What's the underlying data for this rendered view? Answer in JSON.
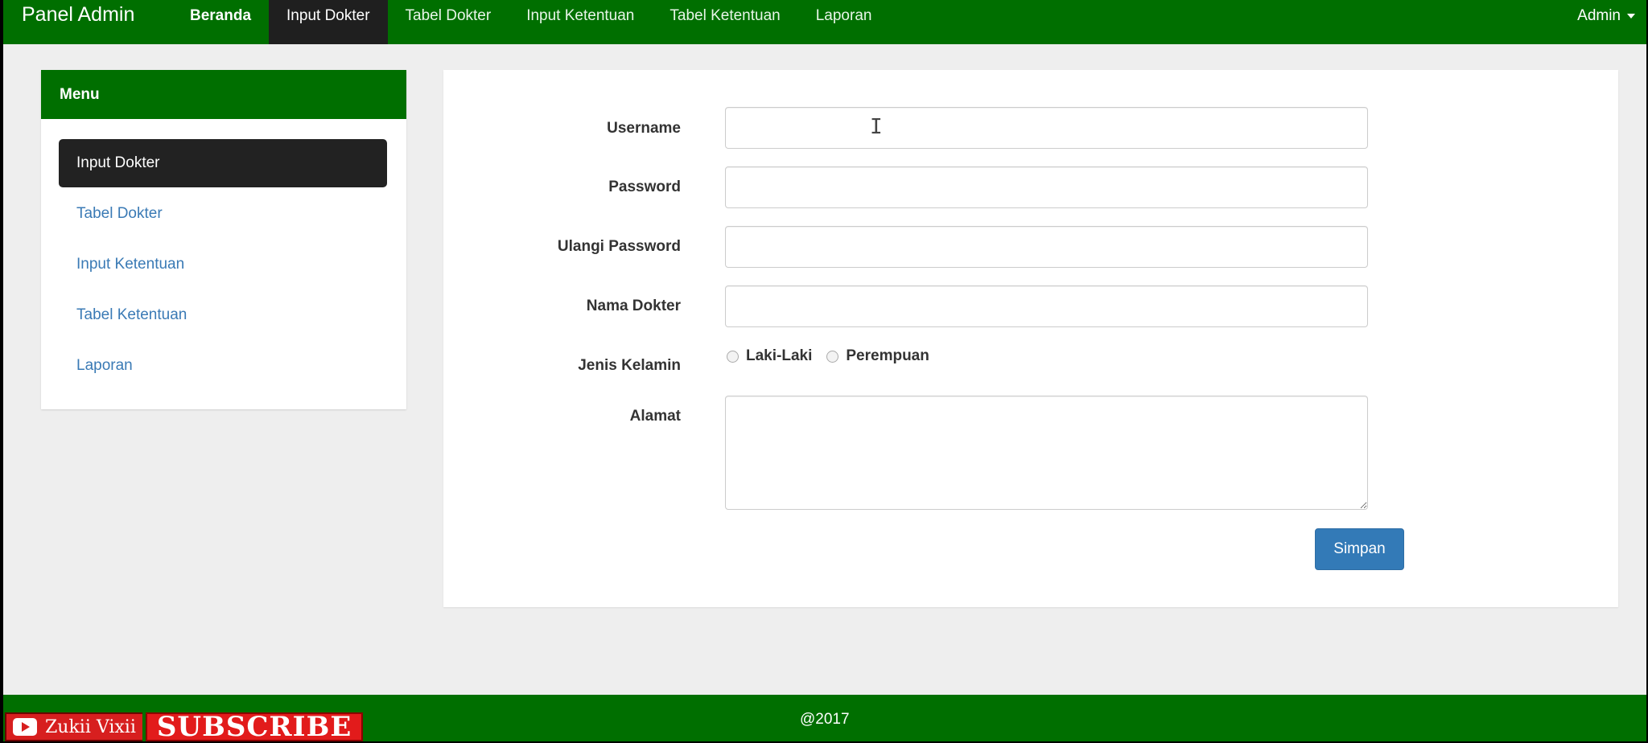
{
  "navbar": {
    "brand": "Panel Admin",
    "items": [
      {
        "label": "Beranda"
      },
      {
        "label": "Input Dokter"
      },
      {
        "label": "Tabel Dokter"
      },
      {
        "label": "Input Ketentuan"
      },
      {
        "label": "Tabel Ketentuan"
      },
      {
        "label": "Laporan"
      }
    ],
    "active_index": 1,
    "user_menu": "Admin"
  },
  "sidebar": {
    "title": "Menu",
    "items": [
      {
        "label": "Input Dokter"
      },
      {
        "label": "Tabel Dokter"
      },
      {
        "label": "Input Ketentuan"
      },
      {
        "label": "Tabel Ketentuan"
      },
      {
        "label": "Laporan"
      }
    ],
    "active_index": 0
  },
  "form": {
    "username_label": "Username",
    "username_value": "",
    "password_label": "Password",
    "password_value": "",
    "repeat_password_label": "Ulangi Password",
    "repeat_password_value": "",
    "doctor_name_label": "Nama Dokter",
    "doctor_name_value": "",
    "gender_label": "Jenis Kelamin",
    "gender_options": [
      {
        "label": "Laki-Laki"
      },
      {
        "label": "Perempuan"
      }
    ],
    "address_label": "Alamat",
    "address_value": "",
    "save_label": "Simpan"
  },
  "footer": {
    "text": "@2017"
  },
  "overlay": {
    "channel_name": "Zukii Vixii",
    "subscribe_label": "SUBSCRIBE"
  },
  "colors": {
    "primary_green": "#006f00",
    "active_dark": "#222222",
    "link_blue": "#3a7ab5",
    "button_blue": "#337ab7",
    "page_bg": "#eeeeee"
  }
}
